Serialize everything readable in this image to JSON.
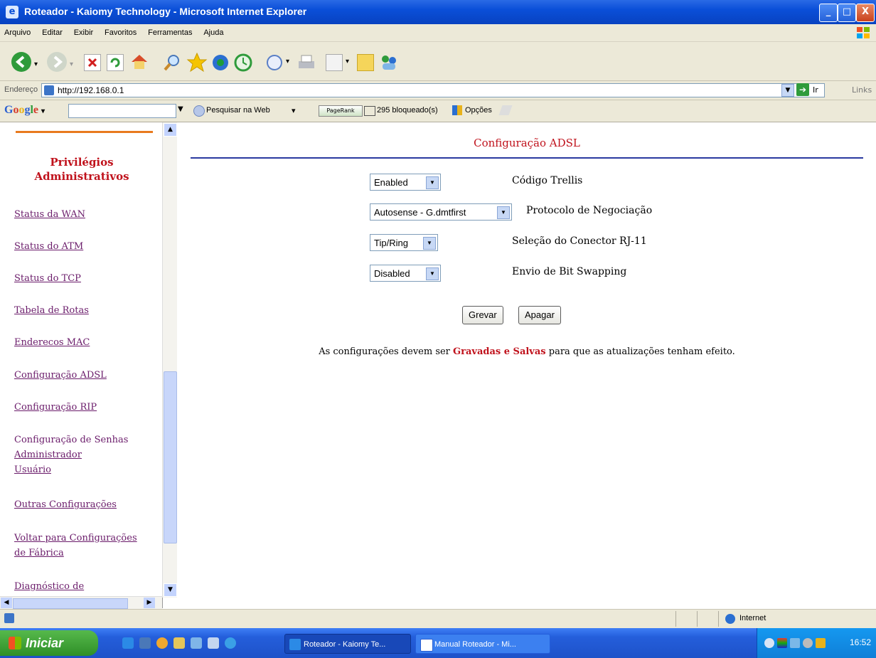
{
  "window": {
    "title": "Roteador - Kaiomy Technology - Microsoft Internet Explorer",
    "minimize": "_",
    "maximize": "□",
    "close": "X"
  },
  "menu": [
    "Arquivo",
    "Editar",
    "Exibir",
    "Favoritos",
    "Ferramentas",
    "Ajuda"
  ],
  "toolbar_icons": [
    "back-icon",
    "forward-icon",
    "stop-icon",
    "refresh-icon",
    "home-icon",
    "search-icon",
    "favorites-icon",
    "media-icon",
    "history-icon",
    "mail-icon",
    "print-icon",
    "edit-icon",
    "discuss-icon",
    "messenger-icon"
  ],
  "address": {
    "label": "Endereço",
    "url": "http://192.168.0.1",
    "go_label": "Ir",
    "links_label": "Links"
  },
  "google_bar": {
    "logo": "Google",
    "search_web": "Pesquisar na Web",
    "pagerank": "PageRank",
    "blocked": "295 bloqueado(s)",
    "options": "Opções"
  },
  "sidebar": {
    "heading_line1": "Privilégios",
    "heading_line2": "Administrativos",
    "items": [
      "Status da WAN",
      "Status do ATM",
      "Status do TCP",
      "Tabela de Rotas",
      "Enderecos MAC",
      "Configuração ADSL",
      "Configuração RIP"
    ],
    "passwords_heading": "Configuração de Senhas",
    "passwords_admin": "Administrador",
    "passwords_user": "Usuário",
    "other_settings": "Outras Configurações",
    "factory_line1": "Voltar para Configurações",
    "factory_line2": "de Fábrica",
    "diagnostic": "Diagnóstico de"
  },
  "main": {
    "title": "Configuração ADSL",
    "settings": [
      {
        "value": "Enabled",
        "label": "Código Trellis"
      },
      {
        "value": "Autosense - G.dmtfirst",
        "label": "Protocolo de Negociação"
      },
      {
        "value": "Tip/Ring",
        "label": "Seleção do Conector RJ-11"
      },
      {
        "value": "Disabled",
        "label": "Envio de Bit Swapping"
      }
    ],
    "save_button": "Grevar",
    "clear_button": "Apagar",
    "note_before": "As configurações devem ser ",
    "note_highlight": "Gravadas e Salvas",
    "note_after": " para que as atualizações tenham efeito."
  },
  "status": {
    "zone": "Internet"
  },
  "taskbar": {
    "start": "Iniciar",
    "tasks": [
      "Roteador - Kaiomy Te...",
      "Manual Roteador - Mi..."
    ],
    "clock": "16:52"
  },
  "colors": {
    "title_blue": "#0a4fd8",
    "accent_red": "#c0121c",
    "link_purple": "#6a1b6a",
    "rule_blue": "#2b3aa0",
    "orange": "#e87a1f"
  }
}
